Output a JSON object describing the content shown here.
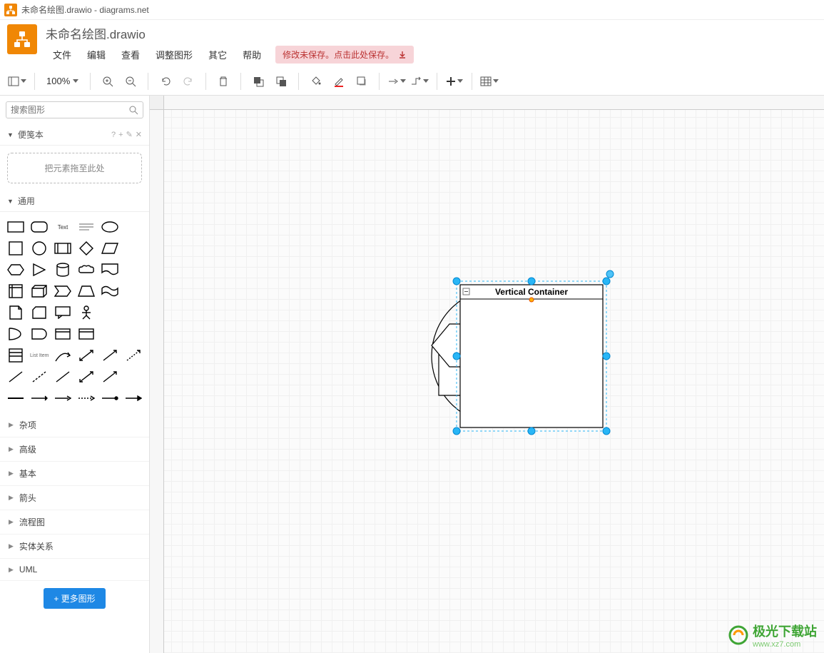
{
  "window": {
    "title": "未命名绘图.drawio - diagrams.net"
  },
  "doc": {
    "title": "未命名绘图.drawio"
  },
  "menu": [
    "文件",
    "编辑",
    "查看",
    "调整图形",
    "其它",
    "帮助"
  ],
  "save_warning": "修改未保存。点击此处保存。",
  "zoom": "100%",
  "sidebar": {
    "search_placeholder": "搜索图形",
    "scratchpad": "便笺本",
    "drop_hint": "把元素拖至此处",
    "general": "通用",
    "categories": [
      "杂项",
      "高级",
      "基本",
      "箭头",
      "流程图",
      "实体关系",
      "UML"
    ],
    "more_shapes": "+ 更多图形"
  },
  "canvas": {
    "container_label": "Vertical Container"
  },
  "watermark": {
    "main": "极光下载站",
    "sub": "www.xz7.com"
  }
}
